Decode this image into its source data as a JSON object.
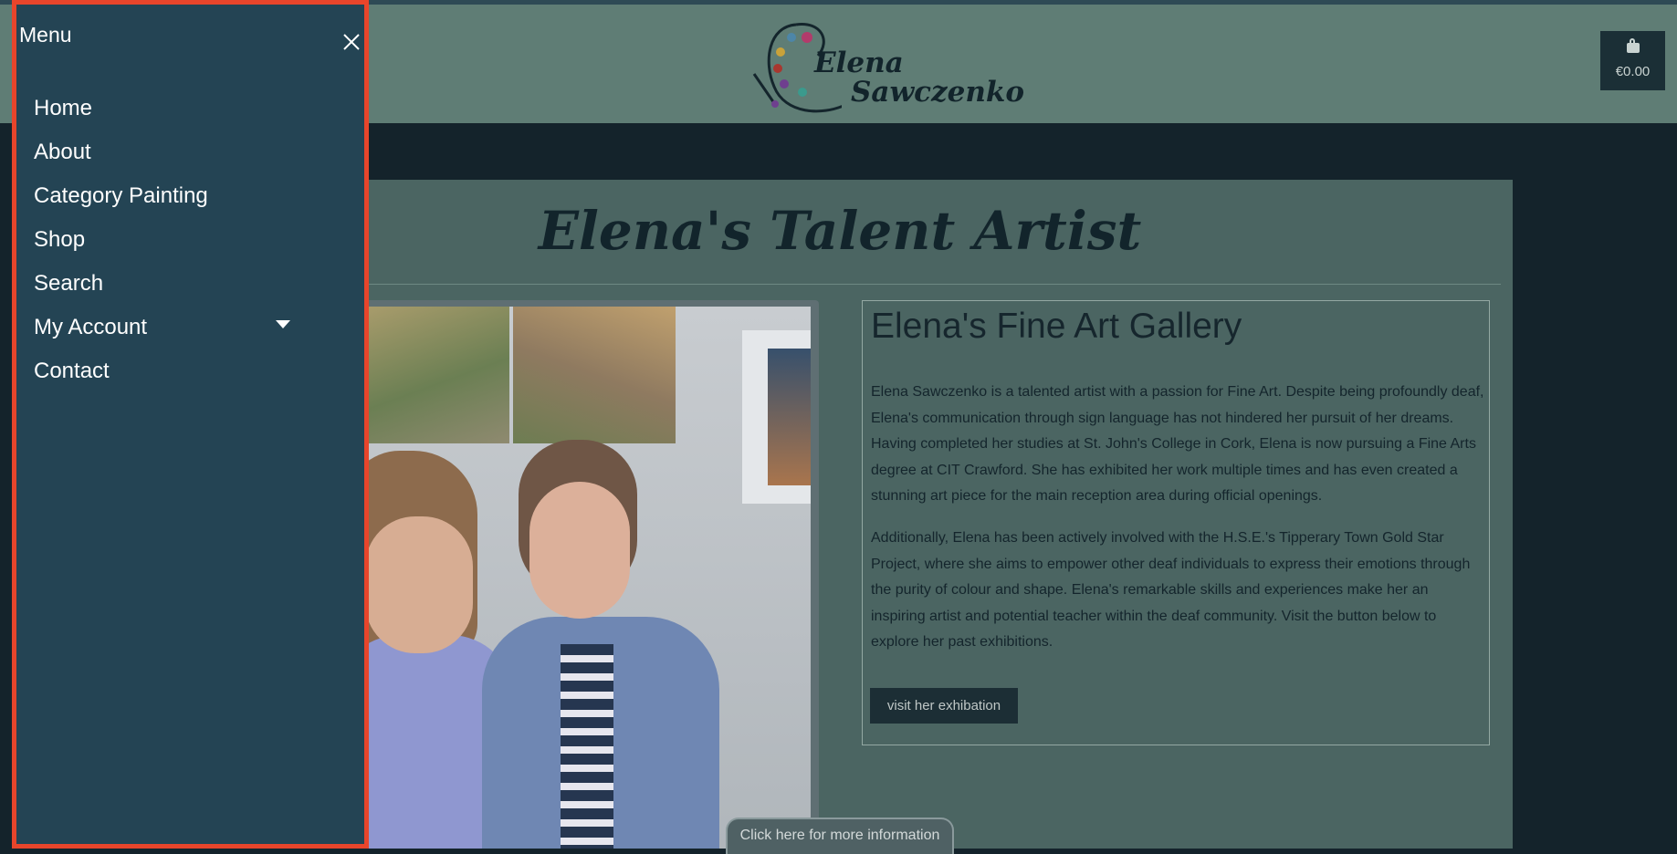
{
  "menu": {
    "title": "Menu",
    "items": [
      {
        "label": "Home"
      },
      {
        "label": "About"
      },
      {
        "label": "Category Painting"
      },
      {
        "label": "Shop"
      },
      {
        "label": "Search"
      },
      {
        "label": "My Account",
        "has_dropdown": true
      },
      {
        "label": "Contact"
      }
    ],
    "border_color": "#e8452b",
    "background": "#244454"
  },
  "header": {
    "logo_line1": "Elena",
    "logo_line2": "Sawczenko",
    "cart_total": "€0.00"
  },
  "main": {
    "title": "Elena's Talent Artist",
    "gallery_title": "Elena's Fine Art Gallery",
    "paragraph1": "Elena Sawczenko is a talented artist with a passion for Fine Art. Despite being profoundly deaf, Elena's communication through sign language has not hindered her pursuit of her dreams. Having completed her studies at St. John's College in Cork, Elena is now pursuing a Fine Arts degree at CIT Crawford. She has exhibited her work multiple times and has even created a stunning art piece for the main reception area during official openings.",
    "paragraph2": "Additionally, Elena has been actively involved with the H.S.E.'s Tipperary Town Gold Star Project, where she aims to empower other deaf individuals to express their emotions through the purity of colour and shape. Elena's remarkable skills and experiences make her an inspiring artist and potential teacher within the deaf community. Visit the button below to explore her past exhibitions.",
    "exhibition_button": "visit her exhibation",
    "info_tab": "Click here for more information"
  },
  "colors": {
    "header_bg": "#5f7d75",
    "page_bg": "#14232b",
    "panel_bg": "#4b6562"
  }
}
